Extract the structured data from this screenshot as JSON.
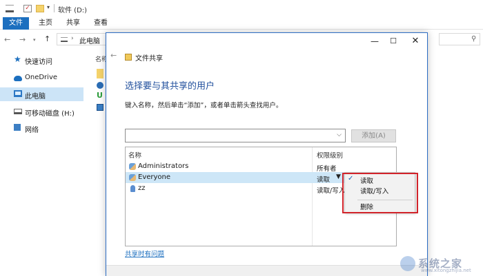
{
  "window": {
    "title": "软件 (D:)"
  },
  "ribbon": {
    "tabs": [
      "文件",
      "主页",
      "共享",
      "查看"
    ]
  },
  "address": {
    "path": "此电脑"
  },
  "sidebar": {
    "items": [
      {
        "label": "快速访问",
        "icon": "star-icon"
      },
      {
        "label": "OneDrive",
        "icon": "cloud-icon"
      },
      {
        "label": "此电脑",
        "icon": "pc-icon",
        "selected": true
      },
      {
        "label": "可移动磁盘 (H:)",
        "icon": "drive-icon"
      },
      {
        "label": "网络",
        "icon": "network-icon"
      }
    ]
  },
  "filelist": {
    "header": "名称"
  },
  "dialog": {
    "caption": "文件共享",
    "heading": "选择要与其共享的用户",
    "instruction": "键入名称，然后单击“添加”，或者单击箭头查找用户。",
    "combo_value": "",
    "add_button": "添加(A)",
    "columns": {
      "name": "名称",
      "permission": "权限级别"
    },
    "rows": [
      {
        "name": "Administrators",
        "permission": "所有者",
        "icon": "group-icon"
      },
      {
        "name": "Everyone",
        "permission": "读取",
        "icon": "group-icon",
        "selected": true
      },
      {
        "name": "zz",
        "permission": "读取/写入",
        "icon": "user-icon"
      }
    ],
    "link": "共享时有问题"
  },
  "context_menu": {
    "items": [
      {
        "label": "读取",
        "checked": true
      },
      {
        "label": "读取/写入",
        "checked": false
      },
      {
        "label": "删除",
        "checked": false
      }
    ],
    "highlight_color": "#d2232a"
  },
  "watermark": {
    "text": "系统之家",
    "url": "www.xitongzhijia.net"
  },
  "colors": {
    "accent": "#1c6fbf",
    "selection": "#cde6f7"
  }
}
